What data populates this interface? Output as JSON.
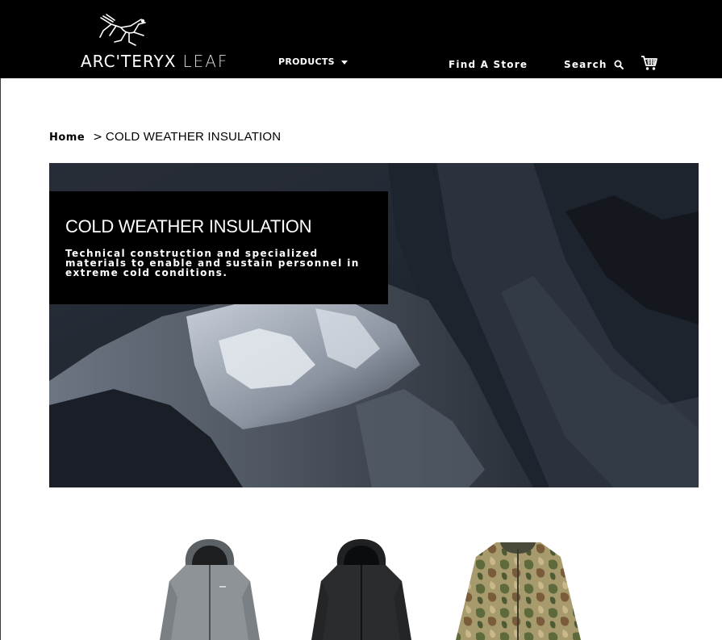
{
  "header": {
    "logo": {
      "brand": "ARC'TERYX",
      "sub": "LEAF"
    },
    "nav": {
      "products_label": "PRODUCTS",
      "find_store_label": "Find A Store",
      "search_label": "Search"
    }
  },
  "breadcrumb": {
    "home_label": "Home",
    "separator": ">",
    "current_label": "COLD WEATHER INSULATION"
  },
  "hero": {
    "title": "COLD WEATHER INSULATION",
    "description": "Technical construction and specialized materials to enable and sustain personnel in extreme cold conditions."
  },
  "products": [
    {
      "image": "grey-hooded-insulated-jacket"
    },
    {
      "image": "black-hooded-insulated-jacket"
    },
    {
      "image": "camouflage-insulated-jacket"
    }
  ],
  "icons": {
    "search": "search-icon",
    "cart": "shopping-cart-icon",
    "dropdown": "caret-down-icon",
    "logo": "archaeopteryx-logo-icon"
  },
  "colors": {
    "header_bg": "#000000",
    "page_bg": "#ffffff",
    "hero_overlay": "#000000",
    "text_dark": "#000000",
    "text_light": "#ffffff"
  }
}
